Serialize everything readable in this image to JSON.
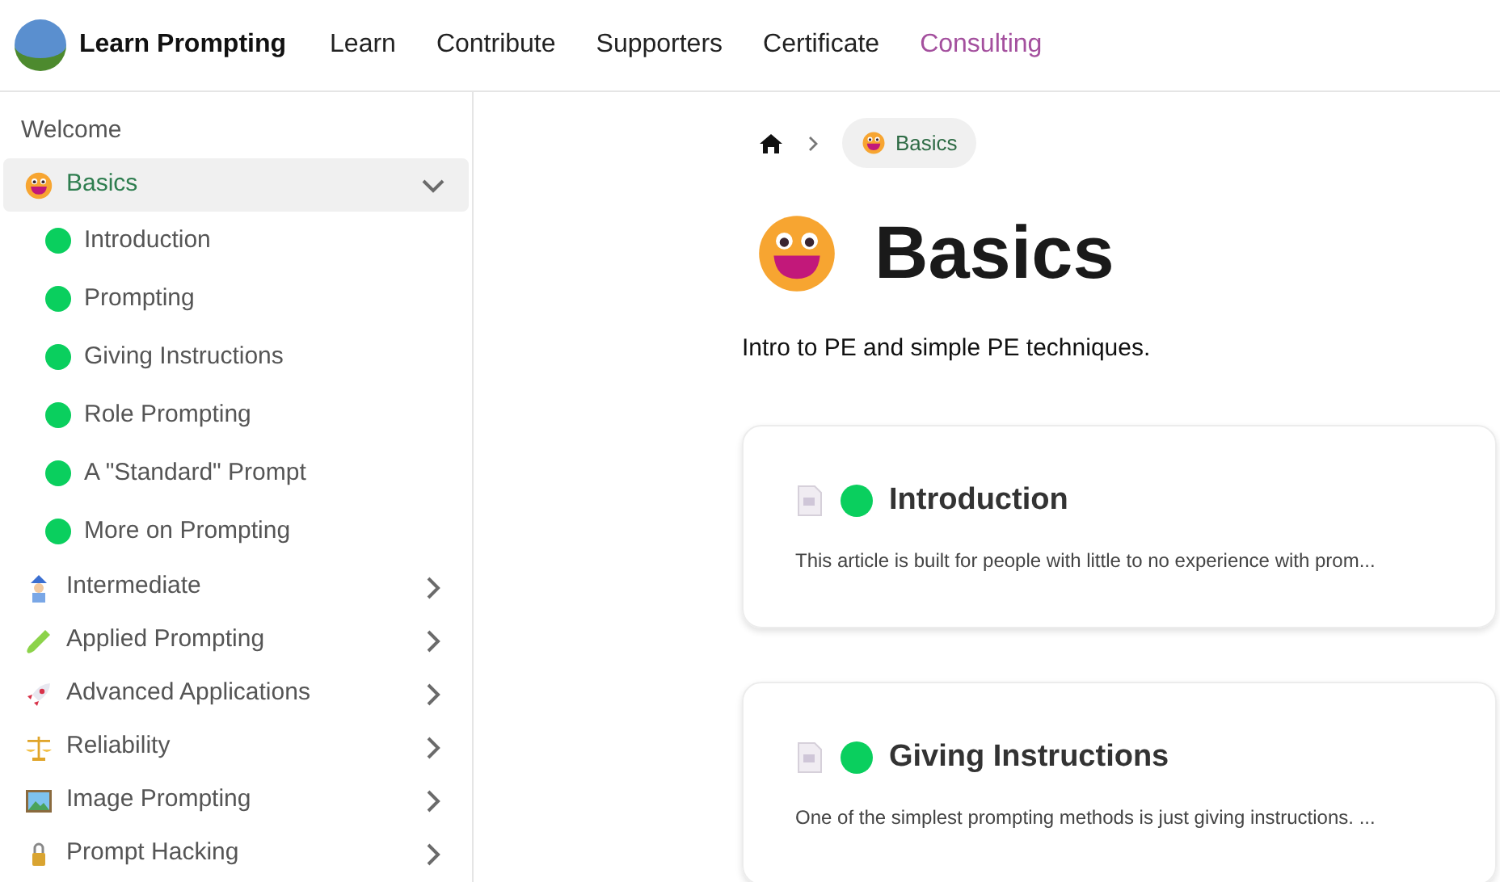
{
  "header": {
    "brand": "Learn Prompting",
    "nav": [
      {
        "label": "Learn",
        "highlighted": false
      },
      {
        "label": "Contribute",
        "highlighted": false
      },
      {
        "label": "Supporters",
        "highlighted": false
      },
      {
        "label": "Certificate",
        "highlighted": false
      },
      {
        "label": "Consulting",
        "highlighted": true
      }
    ]
  },
  "sidebar": {
    "items": [
      {
        "label": "Welcome",
        "kind": "plain",
        "selected": false
      },
      {
        "label": "Basics",
        "kind": "category",
        "selected": true,
        "expanded": true,
        "children": [
          {
            "label": "Introduction",
            "color": "#0acf5e"
          },
          {
            "label": "Prompting",
            "color": "#0acf5e"
          },
          {
            "label": "Giving Instructions",
            "color": "#0acf5e"
          },
          {
            "label": "Role Prompting",
            "color": "#0acf5e"
          },
          {
            "label": "A \"Standard\" Prompt",
            "color": "#0acf5e"
          },
          {
            "label": "More on Prompting",
            "color": "#0acf5e"
          }
        ]
      },
      {
        "label": "Intermediate",
        "kind": "category",
        "selected": false,
        "expanded": false
      },
      {
        "label": "Applied Prompting",
        "kind": "category",
        "selected": false,
        "expanded": false
      },
      {
        "label": "Advanced Applications",
        "kind": "category",
        "selected": false,
        "expanded": false
      },
      {
        "label": "Reliability",
        "kind": "category",
        "selected": false,
        "expanded": false
      },
      {
        "label": "Image Prompting",
        "kind": "category",
        "selected": false,
        "expanded": false
      },
      {
        "label": "Prompt Hacking",
        "kind": "category",
        "selected": false,
        "expanded": false
      }
    ]
  },
  "breadcrumb": {
    "current": "Basics"
  },
  "page": {
    "title": "Basics",
    "description": "Intro to PE and simple PE techniques.",
    "cards": [
      {
        "title": "Introduction",
        "color": "#0acf5e",
        "summary": "This article is built for people with little to no experience with prom..."
      },
      {
        "title": "Giving Instructions",
        "color": "#0acf5e",
        "summary": "One of the simplest prompting methods is just giving instructions. ..."
      }
    ]
  }
}
